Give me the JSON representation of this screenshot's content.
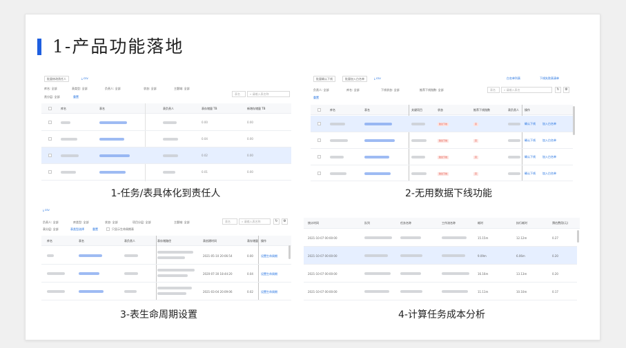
{
  "title": "1-产品功能落地",
  "p1": {
    "caption": "1-任务/表具体化到责任人",
    "btn_batch": "批量修改责任人",
    "export": "csv",
    "filters": [
      "库名: 全部",
      "表类型: 全部",
      "负责人: 全部",
      "状态: 全部",
      "主题域: 全部"
    ],
    "filter2": "责分层: 全部",
    "reset": "重置",
    "search_sel": "表名",
    "search_ph": "请输入表名称",
    "headers": [
      "库名",
      "表名",
      "表负责人",
      "表存储量 TB",
      "新增存储量 TB"
    ],
    "rows": [
      {
        "a": "0.00",
        "b": "0.00"
      },
      {
        "a": "0.04",
        "b": "0.00"
      },
      {
        "a": "0.02",
        "b": "0.00"
      },
      {
        "a": "0.01",
        "b": "0.00"
      }
    ]
  },
  "p2": {
    "caption": "2-无用数据下线功能",
    "btn_a": "批量确认下线",
    "btn_b": "批量加入白名单",
    "export": "csv",
    "link_a": "白名单列表",
    "link_b": "下线失败表清单",
    "filters": [
      "负责人: 全部",
      "库名: 全部",
      "下线状态: 全部",
      "推荐下线指数: 全部"
    ],
    "reset": "重置",
    "search_sel": "表名",
    "search_ph": "请输入表名",
    "headers": [
      "库名",
      "表名",
      "关键项目",
      "状态",
      "推荐下线指数",
      "表负责人",
      "操作"
    ],
    "status": "建议下线",
    "level": "高",
    "act_a": "确认下线",
    "act_b": "加入白名单"
  },
  "p3": {
    "caption": "3-表生命周期设置",
    "export": "csv",
    "filters": [
      "负责人: 全部",
      "库类型: 全部",
      "状态: 全部",
      "项目分层: 全部",
      "主题域: 全部"
    ],
    "filter2": "表分层: 全部",
    "filter3": "表类型选择",
    "reset": "重置",
    "only": "只显示生命周期表",
    "search_sel": "表名",
    "search_ph": "请输入表名称",
    "headers": [
      "库名",
      "表名",
      "表负责人",
      "表存储路径",
      "表创建时间",
      "表存储量",
      "操作"
    ],
    "rows": [
      {
        "t": "2021-05-10 20:06:54",
        "v": "0.00"
      },
      {
        "t": "2020-07-30 18:44:20",
        "v": "0.04"
      },
      {
        "t": "2021-03-04 20:09:06",
        "v": "0.02"
      }
    ],
    "act": "设置生命周期"
  },
  "p4": {
    "caption": "4-计算任务成本分析",
    "headers": [
      "统计时间",
      "队列",
      "任务名称",
      "工作流名称",
      "耗时",
      "执行耗时",
      "预估费用(元)"
    ],
    "rows": [
      {
        "t": "2021-10-07 00:00:00",
        "d": "15.15m",
        "e": "12.12m",
        "c": "0.27"
      },
      {
        "t": "2021-10-07 00:00:00",
        "d": "9.09m",
        "e": "6.06m",
        "c": "0.20"
      },
      {
        "t": "2021-10-07 00:00:00",
        "d": "16.16m",
        "e": "13.13m",
        "c": "0.20"
      },
      {
        "t": "2021-10-07 00:00:00",
        "d": "11.11m",
        "e": "10.10m",
        "c": "0.17"
      }
    ]
  }
}
